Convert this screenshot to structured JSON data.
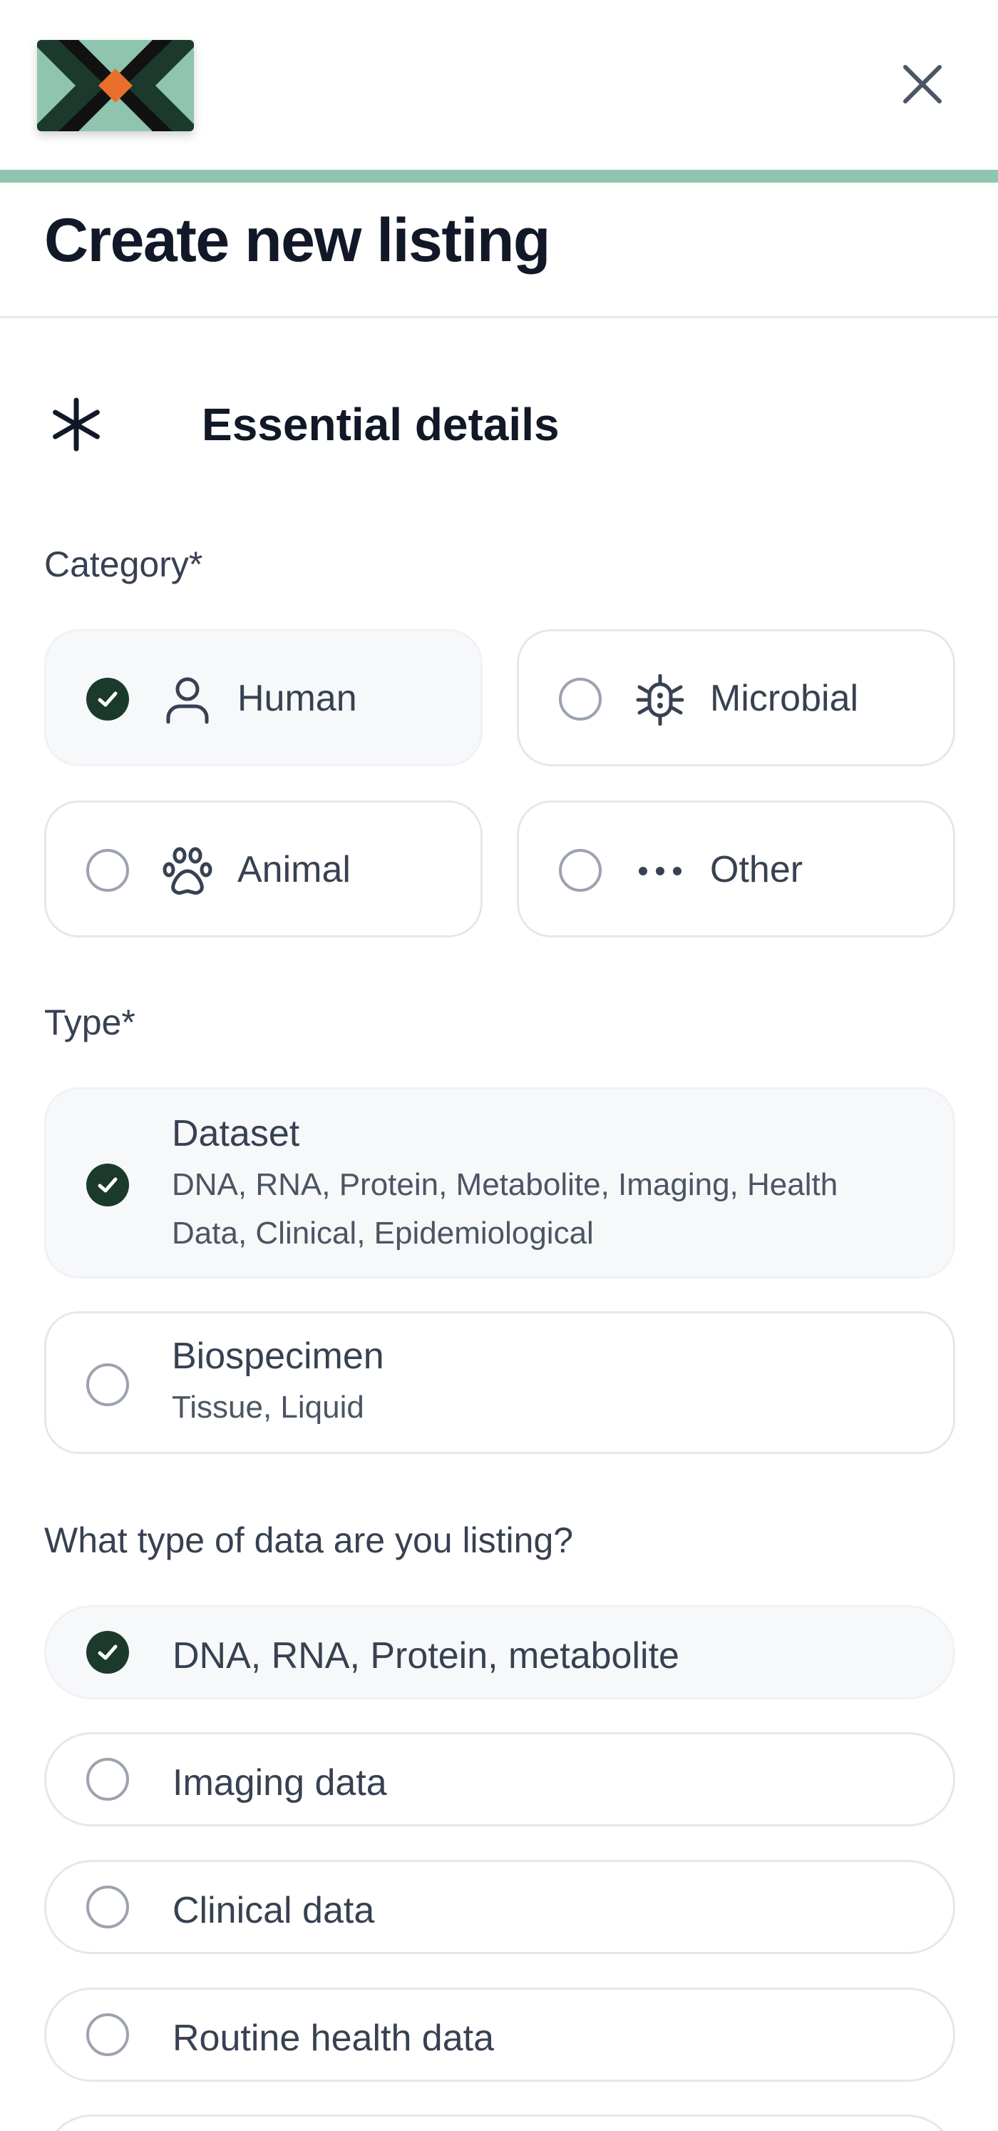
{
  "app": {
    "brand_colors": {
      "green": "#8fc5ae",
      "dark": "#1b3a2c",
      "orange": "#e8702a",
      "black": "#111111"
    }
  },
  "header": {
    "logo_icon": "brand-logo-icon",
    "close_icon": "close-icon"
  },
  "page": {
    "title": "Create new listing"
  },
  "section": {
    "icon": "asterisk-icon",
    "title": "Essential details"
  },
  "category": {
    "label": "Category*",
    "options": [
      {
        "label": "Human",
        "icon": "person-icon",
        "selected": true
      },
      {
        "label": "Microbial",
        "icon": "microbe-icon",
        "selected": false
      },
      {
        "label": "Animal",
        "icon": "paw-icon",
        "selected": false
      },
      {
        "label": "Other",
        "icon": "more-dots-icon",
        "selected": false
      }
    ]
  },
  "type": {
    "label": "Type*",
    "options": [
      {
        "label": "Dataset",
        "description": "DNA, RNA, Protein, Metabolite, Imaging, Health Data, Clinical, Epidemiological",
        "selected": true
      },
      {
        "label": "Biospecimen",
        "description": "Tissue, Liquid",
        "selected": false
      }
    ]
  },
  "data_type": {
    "label": "What type of data are you listing?",
    "options": [
      {
        "label": "DNA, RNA, Protein, metabolite",
        "selected": true
      },
      {
        "label": "Imaging data",
        "selected": false
      },
      {
        "label": "Clinical data",
        "selected": false
      },
      {
        "label": "Routine health data",
        "selected": false
      }
    ]
  }
}
